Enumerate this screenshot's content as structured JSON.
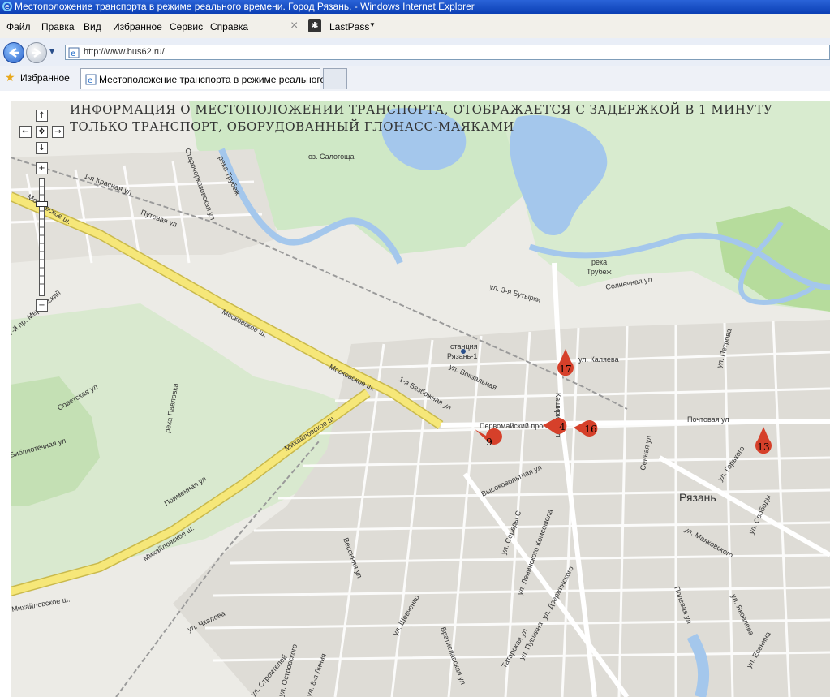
{
  "window": {
    "title": "Местоположение транспорта в режиме реального времени. Город Рязань. - Windows Internet Explorer"
  },
  "menu": {
    "items": [
      "Файл",
      "Правка",
      "Вид",
      "Избранное",
      "Сервис",
      "Справка"
    ],
    "close_glyph": "×",
    "lastpass_label": "LastPass"
  },
  "address": {
    "url": "http://www.bus62.ru/"
  },
  "favorites": {
    "label": "Избранное",
    "tab_title": "Местоположение транспорта в режиме реального ..."
  },
  "map": {
    "info_line1": "ИНФОРМАЦИЯ О МЕСТОПОЛОЖЕНИИ ТРАНСПОРТА, ОТОБРАЖАЕТСЯ С ЗАДЕРЖКОЙ В 1 МИНУТУ",
    "info_line2": "ТОЛЬКО ТРАНСПОРТ, ОБОРУДОВАННЫЙ ГЛОНАСС-МАЯКАМИ",
    "city_label": "Рязань",
    "station_label_1": "станция",
    "station_label_2": "Рязань-1",
    "lake_label": "оз. Салогоща",
    "river_trubezh": "река Трубеж",
    "river_trubezh_2": "река",
    "river_trubezh_3": "Трубеж",
    "river_pavlovka": "река Павловка",
    "zoom_in": "+",
    "zoom_out": "−",
    "streets": {
      "moskovskoe_1": "Московское ш.",
      "moskovskoe_2": "Московское ш.",
      "moskovskoe_3": "Московское ш.",
      "mikhailovskoe_1": "Михайловское ш.",
      "mikhailovskoe_2": "Михайловское ш.",
      "mikhailovskoe_3": "Михайловское ш.",
      "kalyaeva": "ул. Каляева",
      "sennaya": "Сенная ул",
      "pochtovaya": "Почтовая ул",
      "sovetskaya": "Советская ул",
      "poymennaya": "Поименная ул",
      "vysokovoltnaya": "Высоковольтная ул",
      "solnechnaya": "Солнечная ул",
      "chkalova": "ул. Чкалова",
      "shevchenko": "ул. Шевченко",
      "gorkogo": "ул. Горького",
      "svobody": "ул. Свободы",
      "mayakovskogo": "ул. Маяковского",
      "dzerzhinskogo": "ул. Дзержинского",
      "pushkina": "ул. Пушкина",
      "esenina": "ул. Есенина",
      "polevaya": "Полевая ул",
      "vokzalnaya": "ул. Вокзальная",
      "bezbozhnaya": "1-я Безбожная ул",
      "butyrki": "ул. 3-я Бутырки",
      "krasnaya": "1-я Красная ул",
      "putevaya": "Путевая ул",
      "starocherkizovskaya": "Старочерказовская ул",
      "merinsky": "7-й пр. Мервинский",
      "bibliotechnaya": "Библиотечная ул",
      "peresheevsky": "Первомайский просп.",
      "stroiteley": "ул. Строителей",
      "ostrovskogo": "ул. Островского",
      "bratislavskaya": "Братиславская ул",
      "tatarskaya": "Татарская ул",
      "vesennyaya": "Весенняя ул",
      "liniya": "ул. 8-я Линия",
      "leninskogo": "ул. Ленинского Комсомола",
      "seredy": "ул. Середы С",
      "yakovleva": "ул. Яковлева",
      "petrova": "ул. Петрова",
      "kashirina": "Каширина ул"
    },
    "markers": [
      "17",
      "4",
      "16",
      "9",
      "13"
    ],
    "colors": {
      "highway": "#f6e779",
      "water": "#a4c7ec",
      "park": "#a9d38a",
      "marker": "#d6402a"
    }
  }
}
